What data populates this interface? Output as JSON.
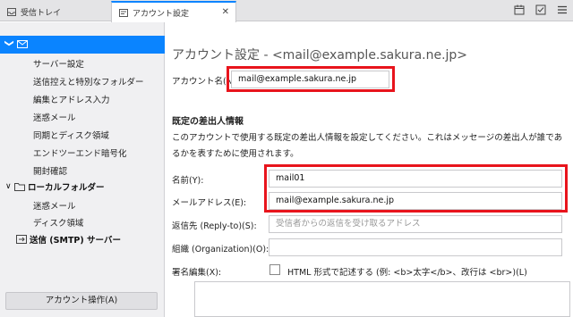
{
  "tabs": [
    {
      "label": "受信トレイ",
      "icon": "inbox-icon"
    },
    {
      "label": "アカウント設定",
      "icon": "settings-tab-icon",
      "close": "✕"
    }
  ],
  "sidebar": {
    "account_chevron": "❯",
    "sections": [
      {
        "label": "サーバー設定"
      },
      {
        "label": "送信控えと特別なフォルダー"
      },
      {
        "label": "編集とアドレス入力"
      },
      {
        "label": "迷惑メール"
      },
      {
        "label": "同期とディスク領域"
      },
      {
        "label": "エンドツーエンド暗号化"
      },
      {
        "label": "開封確認"
      }
    ],
    "local_folders": {
      "label": "ローカルフォルダー",
      "items": [
        {
          "label": "迷惑メール"
        },
        {
          "label": "ディスク領域"
        }
      ]
    },
    "smtp": {
      "label": "送信 (SMTP) サーバー"
    },
    "account_actions_label": "アカウント操作(A)"
  },
  "main": {
    "title": "アカウント設定 - <mail@example.sakura.ne.jp>",
    "account_name_label": "アカウント名(N):",
    "account_name_value": "mail@example.sakura.ne.jp",
    "identity_title": "既定の差出人情報",
    "identity_desc": "このアカウントで使用する既定の差出人情報を設定してください。これはメッセージの差出人が誰であるかを表すために使用されます。",
    "name_label": "名前(Y):",
    "name_value": "mail01",
    "email_label": "メールアドレス(E):",
    "email_value": "mail@example.sakura.ne.jp",
    "reply_to_label": "返信先 (Reply-to)(S):",
    "reply_to_placeholder": "受信者からの返信を受け取るアドレス",
    "organization_label": "組織 (Organization)(O):",
    "organization_value": "",
    "signature_label": "署名編集(X):",
    "html_sig_label": "HTML 形式で記述する (例: <b>太字</b>、改行は <br>)(L)"
  },
  "colors": {
    "accent": "#0a84ff",
    "highlight_box": "#e8141c"
  }
}
